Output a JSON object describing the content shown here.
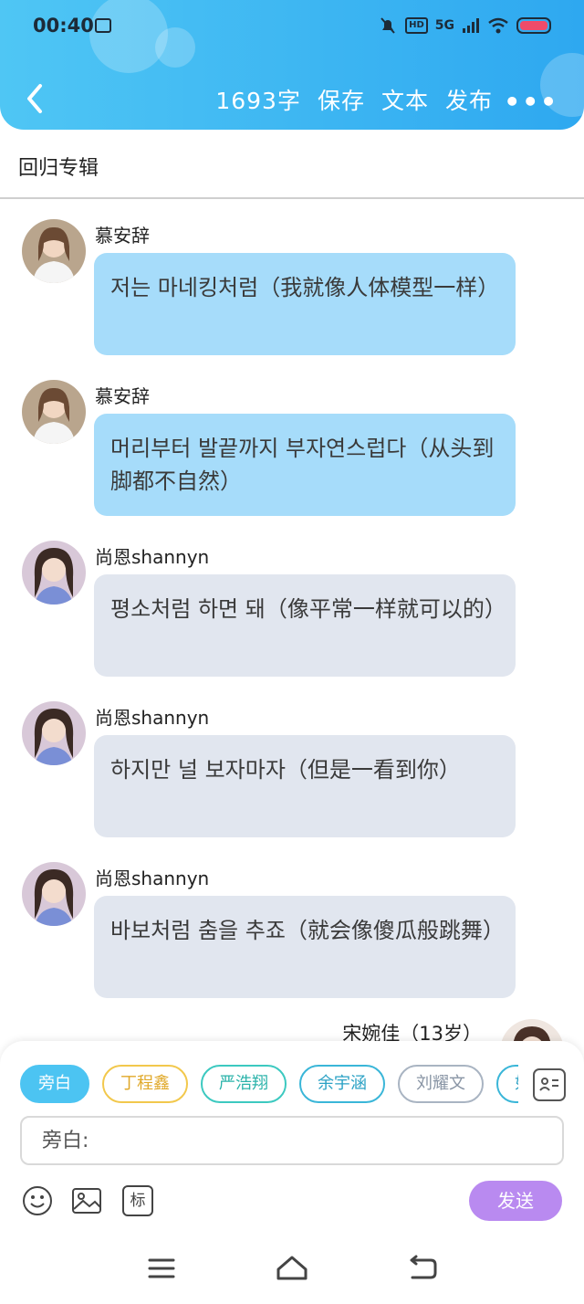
{
  "status_bar": {
    "time": "00:40",
    "network": "5G",
    "hd": "HD",
    "battery_color": "#ef4b6a"
  },
  "header": {
    "word_count": "1693字",
    "save": "保存",
    "text": "文本",
    "publish": "发布",
    "more": "•••",
    "gradient": [
      "#4fc6f4",
      "#2ea8f0"
    ]
  },
  "album": {
    "title": "回归专辑"
  },
  "messages": [
    {
      "speaker": "慕安辞",
      "text": "저는 마네킹처럼（我就像人体模型一样）",
      "style": "blue"
    },
    {
      "speaker": "慕安辞",
      "text": "머리부터 발끝까지 부자연스럽다（从头到脚都不自然）",
      "style": "blue"
    },
    {
      "speaker": "尚恩shannyn",
      "text": "평소처럼 하면 돼（像平常一样就可以的）",
      "style": "gray"
    },
    {
      "speaker": "尚恩shannyn",
      "text": "하지만 널 보자마자（但是一看到你）",
      "style": "gray"
    },
    {
      "speaker": "尚恩shannyn",
      "text": "바보처럼 춤을 추죠（就会像傻瓜般跳舞）",
      "style": "gray"
    }
  ],
  "partial_message": {
    "speaker": "宋婉佳（13岁）"
  },
  "compose": {
    "chips": [
      {
        "label": "旁白",
        "color": "#4cc4f2"
      },
      {
        "label": "丁程鑫",
        "color": "#f2c84c"
      },
      {
        "label": "严浩翔",
        "color": "#3cc9c0"
      },
      {
        "label": "余宇涵",
        "color": "#3ab6d8"
      },
      {
        "label": "刘耀文",
        "color": "#a9b4c2"
      },
      {
        "label": "如",
        "color": "#3ab6d8"
      }
    ],
    "input_placeholder": "旁白:",
    "send": "发送",
    "tag_tool": "标"
  },
  "colors": {
    "bubble_blue": "#a6dcfa",
    "bubble_gray": "#e1e6ef",
    "send_button": "#b98af0"
  }
}
